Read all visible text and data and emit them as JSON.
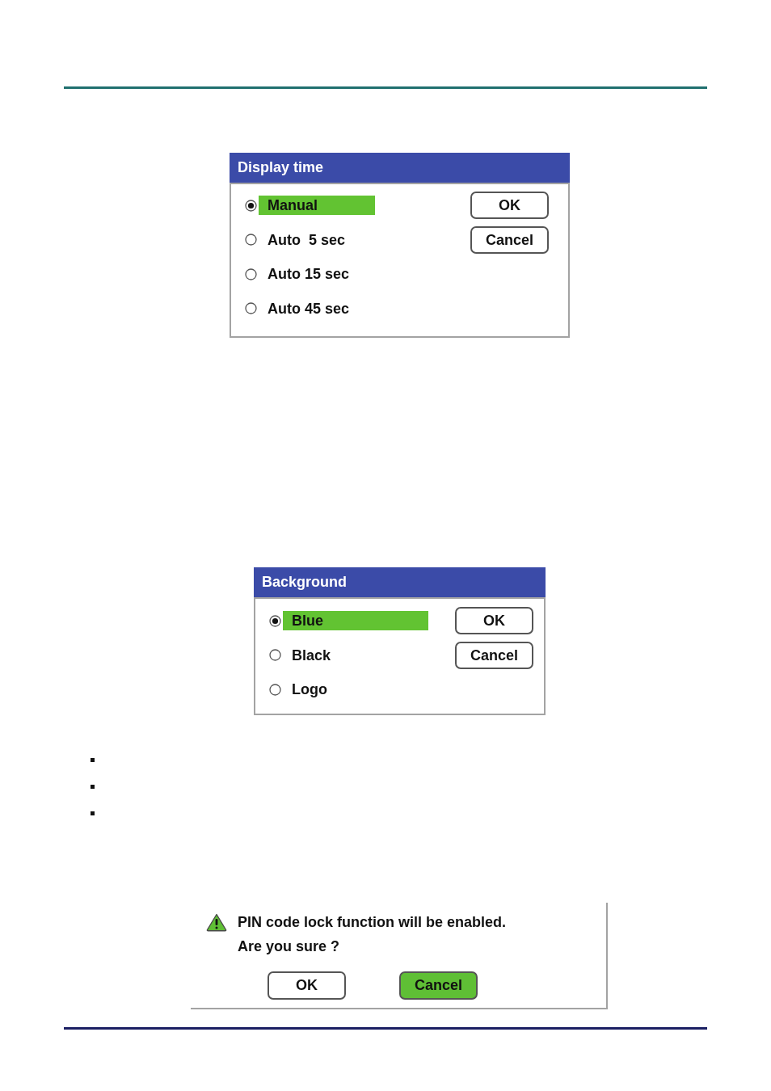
{
  "dialogs": [
    {
      "title": "Display time",
      "options": [
        {
          "label": "Manual",
          "selected": true
        },
        {
          "label": "Auto  5 sec",
          "selected": false
        },
        {
          "label": "Auto 15 sec",
          "selected": false
        },
        {
          "label": "Auto 45 sec",
          "selected": false
        }
      ],
      "buttons": [
        {
          "label": "OK",
          "selected": false
        },
        {
          "label": "Cancel",
          "selected": false
        }
      ]
    },
    {
      "title": "Background",
      "options": [
        {
          "label": "Blue",
          "selected": true
        },
        {
          "label": "Black",
          "selected": false
        },
        {
          "label": "Logo",
          "selected": false
        }
      ],
      "buttons": [
        {
          "label": "OK",
          "selected": false
        },
        {
          "label": "Cancel",
          "selected": false
        }
      ]
    }
  ],
  "bullets": [
    {
      "kind": "square"
    },
    {
      "kind": "square"
    },
    {
      "kind": "square"
    }
  ],
  "confirm": {
    "message": [
      "PIN code lock function will be enabled.",
      "Are you sure ?"
    ],
    "buttons": [
      {
        "label": "OK",
        "selected": false
      },
      {
        "label": "Cancel",
        "selected": true
      }
    ]
  }
}
